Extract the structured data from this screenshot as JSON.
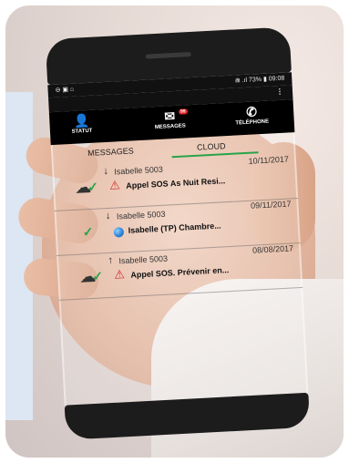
{
  "status_bar": {
    "left_icons": "⊖ ▣ ⌂",
    "right_text": "⋒ .ıl 73% ▮ 09:08"
  },
  "action_bar": {
    "menu_glyph": "⋮"
  },
  "tabs": [
    {
      "label": "STATUT",
      "icon": "person-icon",
      "glyph": "👤"
    },
    {
      "label": "MESSAGES",
      "icon": "envelope-icon",
      "glyph": "✉",
      "badge": "99"
    },
    {
      "label": "TÉLÉPHONE",
      "icon": "phone-icon",
      "glyph": "✆"
    }
  ],
  "subtabs": {
    "messages": "MESSAGES",
    "cloud": "CLOUD"
  },
  "messages": [
    {
      "sender": "Isabelle 5003",
      "date": "10/11/2017",
      "subject": "Appel SOS As Nuit Resi...",
      "type_icon": "warning-icon",
      "direction": "↓"
    },
    {
      "sender": "Isabelle 5003",
      "date": "09/11/2017",
      "subject": "Isabelle (TP) Chambre...",
      "type_icon": "globe-icon",
      "direction": "↓"
    },
    {
      "sender": "Isabelle 5003",
      "date": "08/08/2017",
      "subject": "Appel SOS. Prévenir en...",
      "type_icon": "warning-icon",
      "direction": "↑"
    }
  ],
  "colors": {
    "accent": "#2aa34a",
    "alert": "#d42020",
    "badge": "#e0262a"
  }
}
